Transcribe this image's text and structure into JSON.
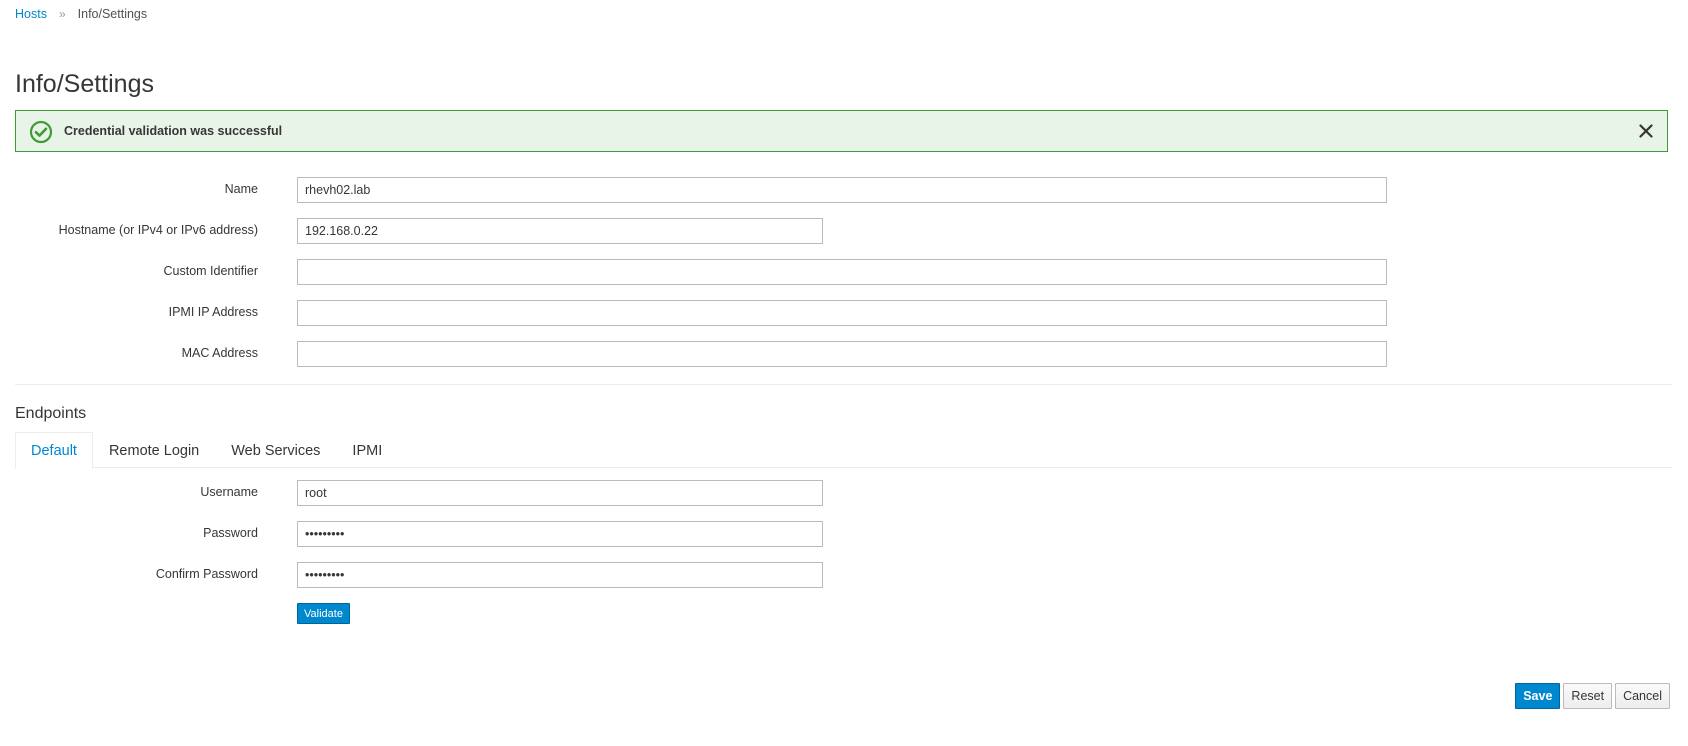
{
  "breadcrumb": {
    "items": [
      {
        "label": "Hosts",
        "link": true
      },
      {
        "label": "Info/Settings",
        "link": false
      }
    ],
    "separator": "»"
  },
  "page": {
    "title": "Info/Settings"
  },
  "alert": {
    "type": "success",
    "icon": "check-circle-icon",
    "message": "Credential validation was successful",
    "close_icon": "close-icon",
    "colors": {
      "border": "#3f9c35",
      "background": "#e9f4e9",
      "icon": "#3f9c35"
    }
  },
  "form": {
    "fields": [
      {
        "label": "Name",
        "value": "rhevh02.lab",
        "placeholder": ""
      },
      {
        "label": "Hostname (or IPv4 or IPv6 address)",
        "value": "192.168.0.22",
        "placeholder": ""
      },
      {
        "label": "Custom Identifier",
        "value": "",
        "placeholder": ""
      },
      {
        "label": "IPMI IP Address",
        "value": "",
        "placeholder": ""
      },
      {
        "label": "MAC Address",
        "value": "",
        "placeholder": ""
      }
    ]
  },
  "endpoints": {
    "title": "Endpoints",
    "tabs": [
      {
        "label": "Default",
        "active": true
      },
      {
        "label": "Remote Login",
        "active": false
      },
      {
        "label": "Web Services",
        "active": false
      },
      {
        "label": "IPMI",
        "active": false
      }
    ],
    "fields": [
      {
        "label": "Username",
        "value": "root",
        "type": "text"
      },
      {
        "label": "Password",
        "value": "•••••••••",
        "type": "password"
      },
      {
        "label": "Confirm Password",
        "value": "•••••••••",
        "type": "password"
      }
    ],
    "validate_label": "Validate"
  },
  "footer": {
    "save_label": "Save",
    "reset_label": "Reset",
    "cancel_label": "Cancel"
  },
  "colors": {
    "accent": "#0088ce",
    "success": "#3f9c35"
  }
}
